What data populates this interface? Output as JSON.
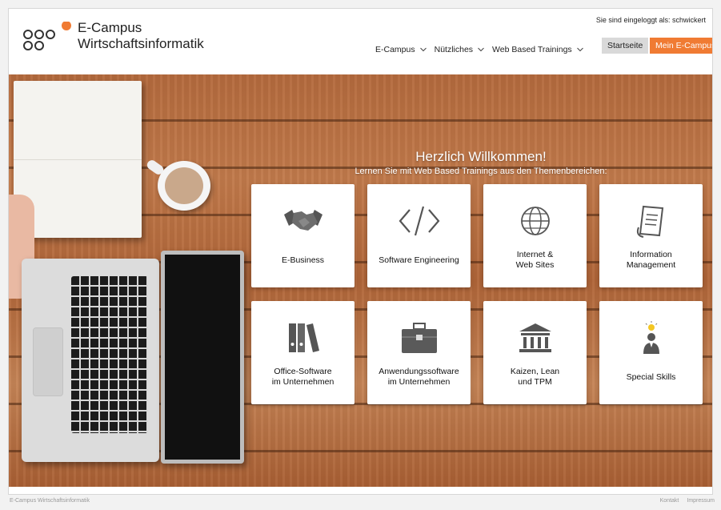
{
  "header": {
    "brand_line1": "E-Campus",
    "brand_line2": "Wirtschaftsinformatik",
    "login_note": "Sie sind eingeloggt als: schwickert",
    "nav": [
      {
        "label": "E-Campus"
      },
      {
        "label": "Nützliches"
      },
      {
        "label": "Web Based Trainings"
      }
    ],
    "btn_start": "Startseite",
    "btn_mine": "Mein E-Campus",
    "accent_color": "#f07b33"
  },
  "hero": {
    "title": "Herzlich Willkommen!",
    "subtitle": "Lernen Sie mit Web Based Trainings aus den Themenbereichen:",
    "tiles": [
      {
        "label": "E-Business",
        "icon": "handshake-icon"
      },
      {
        "label": "Software Engineering",
        "icon": "code-icon"
      },
      {
        "label": "Internet &\nWeb Sites",
        "icon": "globe-icon"
      },
      {
        "label": "Information\nManagement",
        "icon": "document-icon"
      },
      {
        "label": "Office-Software\nim Unternehmen",
        "icon": "binders-icon"
      },
      {
        "label": "Anwendungssoftware\nim Unternehmen",
        "icon": "briefcase-icon"
      },
      {
        "label": "Kaizen, Lean\nund TPM",
        "icon": "institution-icon"
      },
      {
        "label": "Special Skills",
        "icon": "idea-person-icon"
      }
    ]
  },
  "footer": {
    "copyright": "E-Campus Wirtschaftsinformatik",
    "links": [
      {
        "label": "Kontakt"
      },
      {
        "label": "Impressum"
      }
    ]
  }
}
